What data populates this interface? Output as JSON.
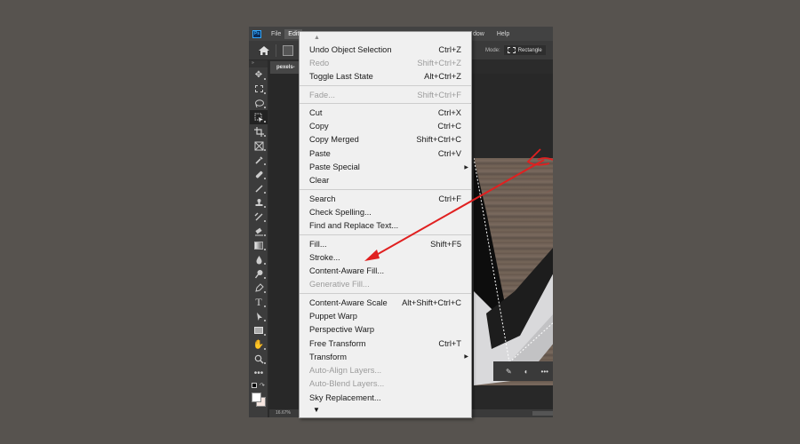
{
  "app": {
    "name": "Photoshop",
    "logo_text": "Ps"
  },
  "menubar": {
    "items": [
      "File",
      "Edit"
    ],
    "right_items": [
      "dow",
      "Help"
    ],
    "active": "Edit"
  },
  "options_bar": {
    "mode_label": "Mode:",
    "mode_value": "Rectangle"
  },
  "document": {
    "tab_label": "pexels-",
    "zoom": "16.67%"
  },
  "toolbar": {
    "tools": [
      "move-tool",
      "marquee-tool",
      "lasso-tool",
      "object-selection-tool",
      "crop-tool",
      "frame-tool",
      "eyedropper-tool",
      "healing-brush-tool",
      "brush-tool",
      "clone-stamp-tool",
      "history-brush-tool",
      "eraser-tool",
      "gradient-tool",
      "blur-tool",
      "dodge-tool",
      "pen-tool",
      "type-tool",
      "path-selection-tool",
      "rectangle-tool",
      "hand-tool",
      "zoom-tool",
      "edit-toolbar"
    ],
    "selected": "object-selection-tool",
    "foreground_color": "#ffffff",
    "background_color": "#f6e6e0"
  },
  "edit_menu": {
    "groups": [
      [
        {
          "label": "Undo Object Selection",
          "shortcut": "Ctrl+Z",
          "enabled": true
        },
        {
          "label": "Redo",
          "shortcut": "Shift+Ctrl+Z",
          "enabled": false
        },
        {
          "label": "Toggle Last State",
          "shortcut": "Alt+Ctrl+Z",
          "enabled": true
        }
      ],
      [
        {
          "label": "Fade...",
          "shortcut": "Shift+Ctrl+F",
          "enabled": false
        }
      ],
      [
        {
          "label": "Cut",
          "shortcut": "Ctrl+X",
          "enabled": true
        },
        {
          "label": "Copy",
          "shortcut": "Ctrl+C",
          "enabled": true
        },
        {
          "label": "Copy Merged",
          "shortcut": "Shift+Ctrl+C",
          "enabled": true
        },
        {
          "label": "Paste",
          "shortcut": "Ctrl+V",
          "enabled": true
        },
        {
          "label": "Paste Special",
          "shortcut": "",
          "enabled": true,
          "submenu": true
        },
        {
          "label": "Clear",
          "shortcut": "",
          "enabled": true
        }
      ],
      [
        {
          "label": "Search",
          "shortcut": "Ctrl+F",
          "enabled": true
        },
        {
          "label": "Check Spelling...",
          "shortcut": "",
          "enabled": true
        },
        {
          "label": "Find and Replace Text...",
          "shortcut": "",
          "enabled": true
        }
      ],
      [
        {
          "label": "Fill...",
          "shortcut": "Shift+F5",
          "enabled": true
        },
        {
          "label": "Stroke...",
          "shortcut": "",
          "enabled": true
        },
        {
          "label": "Content-Aware Fill...",
          "shortcut": "",
          "enabled": true
        },
        {
          "label": "Generative Fill...",
          "shortcut": "",
          "enabled": false
        }
      ],
      [
        {
          "label": "Content-Aware Scale",
          "shortcut": "Alt+Shift+Ctrl+C",
          "enabled": true
        },
        {
          "label": "Puppet Warp",
          "shortcut": "",
          "enabled": true
        },
        {
          "label": "Perspective Warp",
          "shortcut": "",
          "enabled": true
        },
        {
          "label": "Free Transform",
          "shortcut": "Ctrl+T",
          "enabled": true
        },
        {
          "label": "Transform",
          "shortcut": "",
          "enabled": true,
          "submenu": true
        },
        {
          "label": "Auto-Align Layers...",
          "shortcut": "",
          "enabled": false
        },
        {
          "label": "Auto-Blend Layers...",
          "shortcut": "",
          "enabled": false
        },
        {
          "label": "Sky Replacement...",
          "shortcut": "",
          "enabled": true
        }
      ]
    ]
  },
  "annotation": {
    "color": "#e02020",
    "points_to": "Stroke..."
  }
}
